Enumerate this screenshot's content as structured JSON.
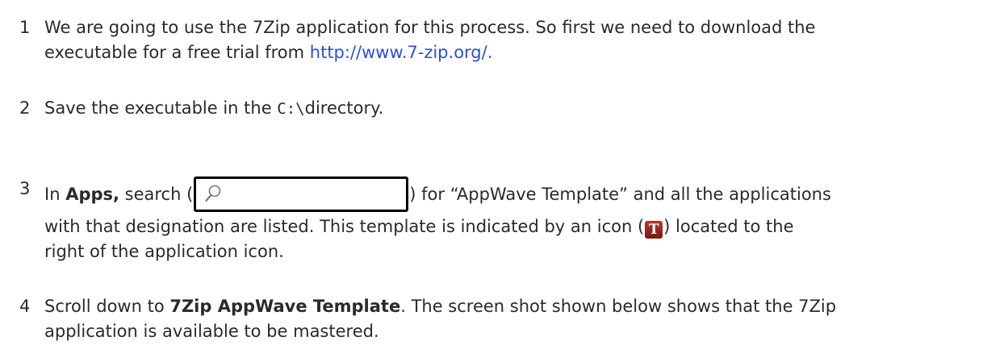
{
  "steps": [
    {
      "num": "1",
      "line1": "We are going to use the 7Zip application for this process. So first we need to download the",
      "line2_pre": "executable for a free trial from ",
      "link": "http://www.7-zip.org/.",
      "line2_post": ""
    },
    {
      "num": "2",
      "pre": "Save the executable in the ",
      "code": "C:\\",
      "post": "directory."
    },
    {
      "num": "3",
      "pre": "In ",
      "bold": "Apps,",
      "mid": " search (",
      "post": ") for “AppWave Template” and all the applications",
      "line2_pre": "with that designation are listed. This template is indicated by an icon (",
      "icon_letter": "T",
      "line2_post": ") located to the",
      "line3": "right of the application icon."
    },
    {
      "num": "4",
      "pre": "Scroll down to ",
      "bold": "7Zip AppWave Template",
      "post": ". The screen shot shown below shows that the 7Zip",
      "line2": "application is available to be mastered."
    }
  ],
  "icons": {
    "search": "magnifier-icon",
    "template": "template-t-icon"
  },
  "colors": {
    "link": "#2d4fd8",
    "template_icon": "#9b2a25"
  }
}
